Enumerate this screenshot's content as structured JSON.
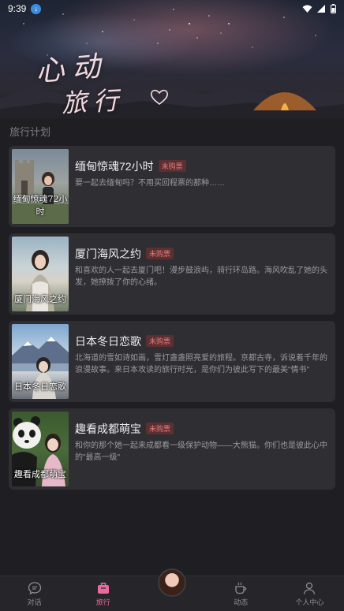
{
  "status_bar": {
    "time": "9:39",
    "download_badge": "↓"
  },
  "hero": {
    "line1": "心动",
    "line2": "旅行"
  },
  "section_title": "旅行计划",
  "cards": [
    {
      "title": "缅甸惊魂72小时",
      "badge": "未购票",
      "desc": "要一起去缅甸吗？不用买回程票的那种……",
      "thumb_caption": "缅甸惊魂72小时",
      "thumb_colors": [
        "#7b8a9a",
        "#9da3a0",
        "#5c6b4a"
      ]
    },
    {
      "title": "厦门海风之约",
      "badge": "未购票",
      "desc": "和喜欢的人一起去厦门吧！漫步鼓浪屿，骑行环岛路。海风吹乱了她的头发，她撩拨了你的心绪。",
      "thumb_caption": "厦门海风之约",
      "thumb_colors": [
        "#9bb3c3",
        "#d7d2c6",
        "#6f7c6a"
      ]
    },
    {
      "title": "日本冬日恋歌",
      "badge": "未购票",
      "desc": "北海道的雪如诗如画，雪灯盏盏照亮爱的旅程。京都古寺，诉说着千年的浪漫故事。来日本攻读的旅行时光，是你们为彼此写下的最美\"情书\"",
      "thumb_caption": "日本冬日恋歌",
      "thumb_colors": [
        "#7fa6cf",
        "#e6ecef",
        "#6a6f77"
      ]
    },
    {
      "title": "趣看成都萌宝",
      "badge": "未购票",
      "desc": "和你的那个她一起来成都看一级保护动物——大熊猫。你们也是彼此心中的\"最高一级\"",
      "thumb_caption": "趣看成都萌宝",
      "thumb_colors": [
        "#4a6b3a",
        "#e9e6e0",
        "#2c2c2c"
      ]
    }
  ],
  "tabbar": {
    "items": [
      {
        "label": "对话",
        "icon": "chat-icon"
      },
      {
        "label": "旅行",
        "icon": "suitcase-icon",
        "active": true
      },
      {
        "label": "",
        "icon": "avatar"
      },
      {
        "label": "动态",
        "icon": "coffee-icon"
      },
      {
        "label": "个人中心",
        "icon": "person-icon"
      }
    ]
  },
  "colors": {
    "accent": "#e86a9e",
    "badge_text": "#e67b7b",
    "card_bg": "#2e2e33",
    "page_bg": "#1f1f23"
  }
}
